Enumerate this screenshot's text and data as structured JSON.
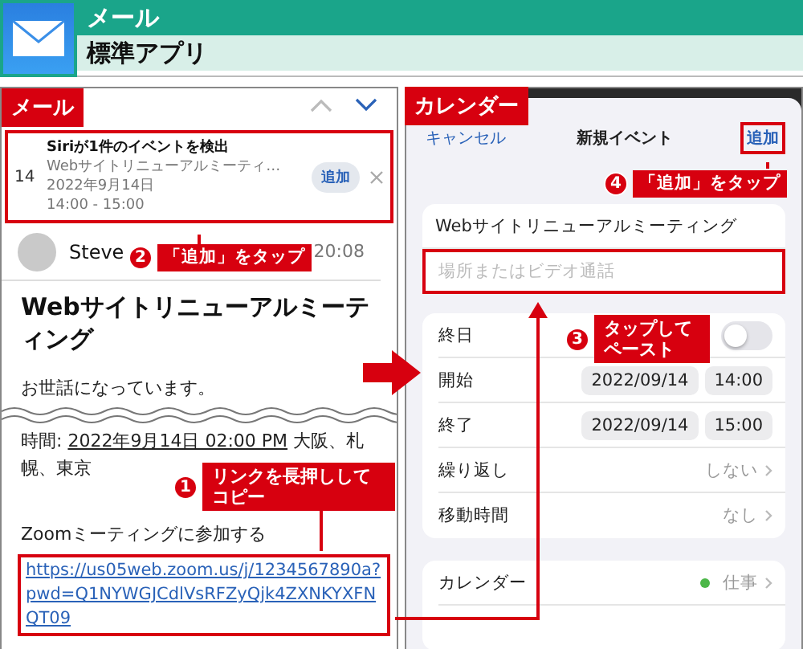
{
  "header": {
    "app_name": "メール",
    "category": "標準アプリ"
  },
  "mail": {
    "label": "メール",
    "suggestion": {
      "day": "14",
      "title": "Siriが1件のイベントを検出",
      "event": "Webサイトリニューアルミーティ…",
      "date": "2022年9月14日",
      "time": "14:00 - 15:00",
      "add_button": "追加"
    },
    "sender": {
      "name": "Steve",
      "time": "20:08"
    },
    "subject": "Webサイトリニューアルミーティング",
    "greeting": "お世話になっています。",
    "time_prefix": "時間:",
    "time_value": "2022年9月14日 02:00 PM",
    "time_place": "大阪、札幌、東京",
    "join_text": "Zoomミーティングに参加する",
    "link": "https://us05web.zoom.us/j/1234567890a?pwd=Q1NYWGJCdlVsRFZyQjk4ZXNKYXFNQT09"
  },
  "calendar": {
    "label": "カレンダー",
    "cancel": "キャンセル",
    "title": "新規イベント",
    "add": "追加",
    "event_title": "Webサイトリニューアルミーティング",
    "location_placeholder": "場所またはビデオ通話",
    "rows": [
      {
        "kind": "toggle",
        "label": "終日",
        "on": false
      },
      {
        "kind": "datetime",
        "label": "開始",
        "date": "2022/09/14",
        "time": "14:00"
      },
      {
        "kind": "datetime",
        "label": "終了",
        "date": "2022/09/14",
        "time": "15:00"
      },
      {
        "kind": "detail",
        "label": "繰り返し",
        "value": "しない"
      },
      {
        "kind": "detail",
        "label": "移動時間",
        "value": "なし"
      }
    ],
    "calendar_row": {
      "label": "カレンダー",
      "value": "仕事"
    }
  },
  "callouts": [
    {
      "number": "4",
      "text": "「追加」をタップ"
    },
    {
      "number": "2",
      "text": "「追加」をタップ"
    },
    {
      "number": "3",
      "text": "タップしてペースト"
    },
    {
      "number": "1",
      "text": "リンクを長押ししてコピー"
    }
  ]
}
